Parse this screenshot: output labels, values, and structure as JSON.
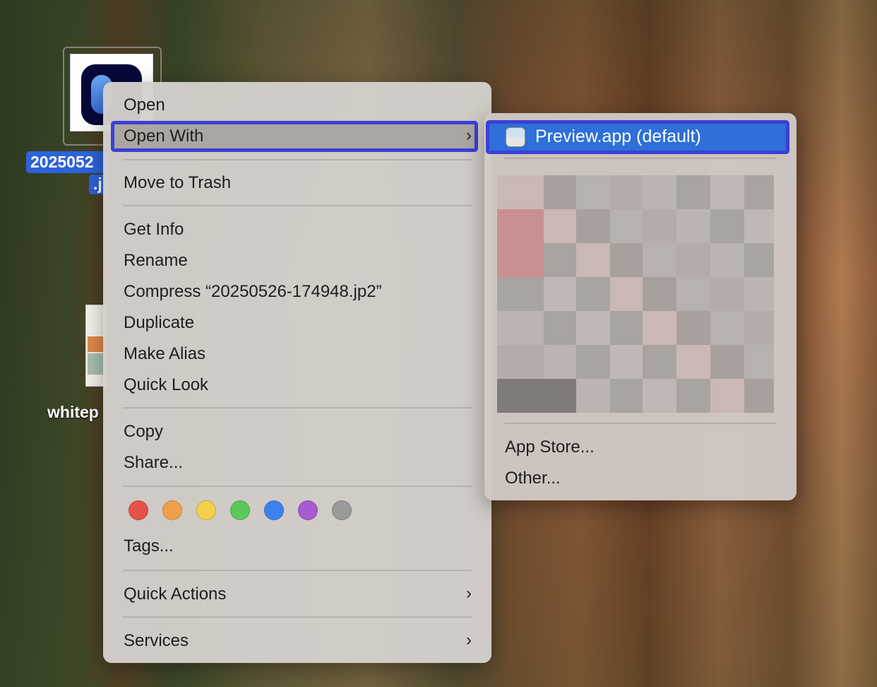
{
  "desktop": {
    "selected_file_label_line1": "2025052",
    "selected_file_label_line2": ".j",
    "other_file_label": "whitep"
  },
  "context_menu": {
    "items": {
      "open": "Open",
      "open_with": "Open With",
      "move_to_trash": "Move to Trash",
      "get_info": "Get Info",
      "rename": "Rename",
      "compress": "Compress “20250526-174948.jp2”",
      "duplicate": "Duplicate",
      "make_alias": "Make Alias",
      "quick_look": "Quick Look",
      "copy": "Copy",
      "share": "Share...",
      "tags": "Tags...",
      "quick_actions": "Quick Actions",
      "services": "Services"
    },
    "tag_colors": [
      "#e8504a",
      "#f0a04a",
      "#f4d04a",
      "#5cc85a",
      "#3d82f0",
      "#a85ad0",
      "#9a9a9a"
    ],
    "submenu_chevron": "›"
  },
  "open_with_submenu": {
    "default_app": "Preview.app (default)",
    "app_store": "App Store...",
    "other": "Other..."
  },
  "colors": {
    "highlight": "#2e6fd8",
    "focus_outline": "#3b3fd6"
  }
}
